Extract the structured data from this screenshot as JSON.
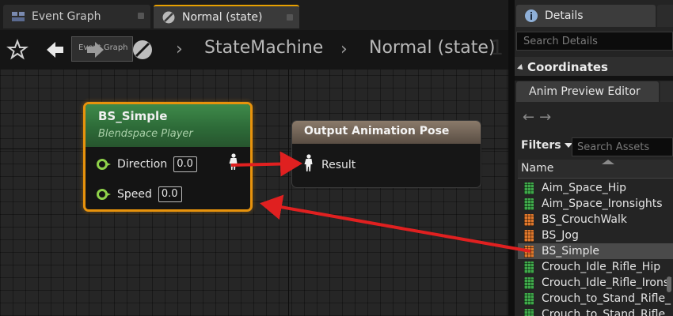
{
  "tabs": [
    {
      "label": "Event Graph",
      "icon": "event-graph-icon",
      "active": false
    },
    {
      "label": "Normal (state)",
      "icon": "state-icon",
      "active": true
    }
  ],
  "breadcrumb": {
    "items": [
      "StateMachine",
      "Normal (state)"
    ],
    "tooltip": "Event Graph",
    "watermark": "1"
  },
  "nodes": {
    "blendspace": {
      "title": "BS_Simple",
      "subtitle": "Blendspace Player",
      "pins": [
        {
          "label": "Direction",
          "value": "0.0"
        },
        {
          "label": "Speed",
          "value": "0.0"
        }
      ]
    },
    "output": {
      "title": "Output Animation Pose",
      "pin_label": "Result"
    }
  },
  "details": {
    "tab_label": "Details",
    "search_placeholder": "Search Details",
    "section": "Coordinates"
  },
  "asset_browser": {
    "tab_label": "Anim Preview Editor",
    "filters_label": "Filters",
    "search_placeholder": "Search Assets",
    "column_name": "Name",
    "assets": [
      {
        "name": "Aim_Space_Hip",
        "type": "green"
      },
      {
        "name": "Aim_Space_Ironsights",
        "type": "green"
      },
      {
        "name": "BS_CrouchWalk",
        "type": "orange"
      },
      {
        "name": "BS_Jog",
        "type": "orange"
      },
      {
        "name": "BS_Simple",
        "type": "orange",
        "selected": true
      },
      {
        "name": "Crouch_Idle_Rifle_Hip",
        "type": "green"
      },
      {
        "name": "Crouch_Idle_Rifle_Ironsi",
        "type": "green"
      },
      {
        "name": "Crouch_to_Stand_Rifle_",
        "type": "green"
      },
      {
        "name": "Crouch_to_Stand_Rifle_",
        "type": "green"
      }
    ]
  },
  "colors": {
    "accent_orange": "#e8930c",
    "annotation_red": "#e02020",
    "asset_green": "#3fa84a",
    "asset_orange": "#e0782c"
  }
}
